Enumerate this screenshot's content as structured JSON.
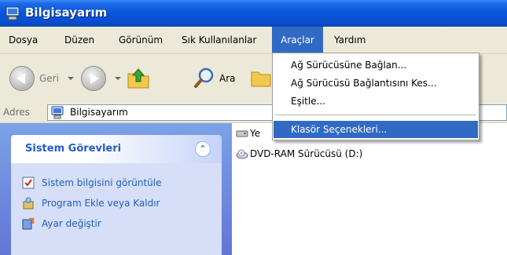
{
  "window": {
    "title": "Bilgisayarım",
    "icon": "computer-icon"
  },
  "menubar": {
    "items": [
      {
        "label": "Dosya"
      },
      {
        "label": "Düzen"
      },
      {
        "label": "Görünüm"
      },
      {
        "label": "Sık Kullanılanlar"
      },
      {
        "label": "Araçlar",
        "active": true
      },
      {
        "label": "Yardım"
      }
    ]
  },
  "toolbar": {
    "back_label": "Geri",
    "search_label": "Ara",
    "icons": [
      "back-icon",
      "forward-icon",
      "folder-up-icon",
      "search-icon",
      "folders-icon"
    ]
  },
  "address": {
    "label": "Adres",
    "value": "Bilgisayarım",
    "icon": "computer-icon"
  },
  "tools_menu": {
    "items": [
      {
        "label": "Ağ Sürücüsüne Bağlan..."
      },
      {
        "label": "Ağ Sürücüsü Bağlantısını Kes..."
      },
      {
        "label": "Eşitle..."
      },
      {
        "label": "Klasör Seçenekleri...",
        "highlighted": true
      }
    ]
  },
  "tasks_panel": {
    "title": "Sistem Görevleri",
    "items": [
      {
        "label": "Sistem bilgisini görüntüle",
        "icon": "system-info-icon"
      },
      {
        "label": "Program Ekle veya Kaldır",
        "icon": "add-remove-programs-icon"
      },
      {
        "label": "Ayar değiştir",
        "icon": "control-panel-icon"
      }
    ]
  },
  "drives": [
    {
      "label": "Ye",
      "icon": "drive-icon"
    },
    {
      "label": "DVD-RAM Sürücüsü (D:)",
      "icon": "dvd-drive-icon"
    }
  ],
  "colors": {
    "title_bar": "#0a56d8",
    "highlight": "#316ac5",
    "task_link": "#215dc6",
    "menu_bg": "#ece9d8"
  }
}
